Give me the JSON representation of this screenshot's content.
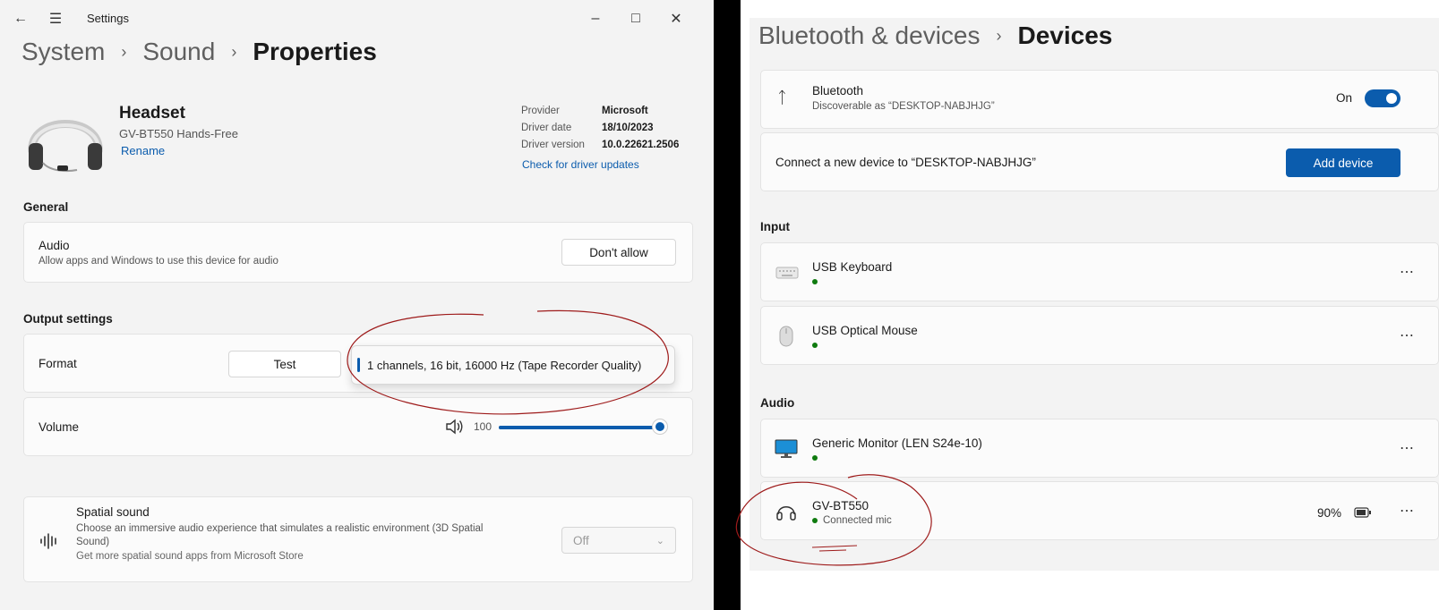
{
  "left": {
    "window_title": "Settings",
    "breadcrumb": [
      "System",
      "Sound",
      "Properties"
    ],
    "device": {
      "name": "Headset",
      "model": "GV-BT550 Hands-Free",
      "rename_label": "Rename"
    },
    "driver": {
      "rows": [
        {
          "key": "Provider",
          "value": "Microsoft"
        },
        {
          "key": "Driver date",
          "value": "18/10/2023"
        },
        {
          "key": "Driver version",
          "value": "10.0.22621.2506"
        }
      ],
      "update_link": "Check for driver updates"
    },
    "general": {
      "label": "General",
      "audio_title": "Audio",
      "audio_sub": "Allow apps and Windows to use this device for audio",
      "audio_button": "Don't allow"
    },
    "output": {
      "label": "Output settings",
      "format_label": "Format",
      "test_button": "Test",
      "format_value": "1 channels, 16 bit, 16000 Hz (Tape Recorder Quality)",
      "volume_label": "Volume",
      "volume_value": "100",
      "volume_level": 1.0
    },
    "spatial": {
      "title": "Spatial sound",
      "sub": "Choose an immersive audio experience that simulates a realistic environment (3D Spatial Sound)",
      "link": "Get more spatial sound apps from Microsoft Store",
      "value": "Off"
    }
  },
  "right": {
    "breadcrumb": [
      "Bluetooth & devices",
      "Devices"
    ],
    "bluetooth": {
      "title": "Bluetooth",
      "sub": "Discoverable as “DESKTOP-NABJHJG”",
      "state": "On"
    },
    "connect": {
      "text": "Connect a new device to “DESKTOP-NABJHJG”",
      "button": "Add device"
    },
    "input_label": "Input",
    "input_devices": [
      {
        "name": "USB Keyboard",
        "icon": "keyboard-icon"
      },
      {
        "name": "USB Optical Mouse",
        "icon": "mouse-icon"
      }
    ],
    "audio_label": "Audio",
    "audio_devices": [
      {
        "name": "Generic Monitor (LEN S24e-10)",
        "icon": "monitor-icon"
      },
      {
        "name": "GV-BT550",
        "status": "Connected mic",
        "battery": "90%",
        "icon": "headphones-icon"
      }
    ]
  },
  "colors": {
    "accent": "#0b5cad",
    "status_green": "#0f7b0f",
    "annotation": "#9e1b1b"
  }
}
